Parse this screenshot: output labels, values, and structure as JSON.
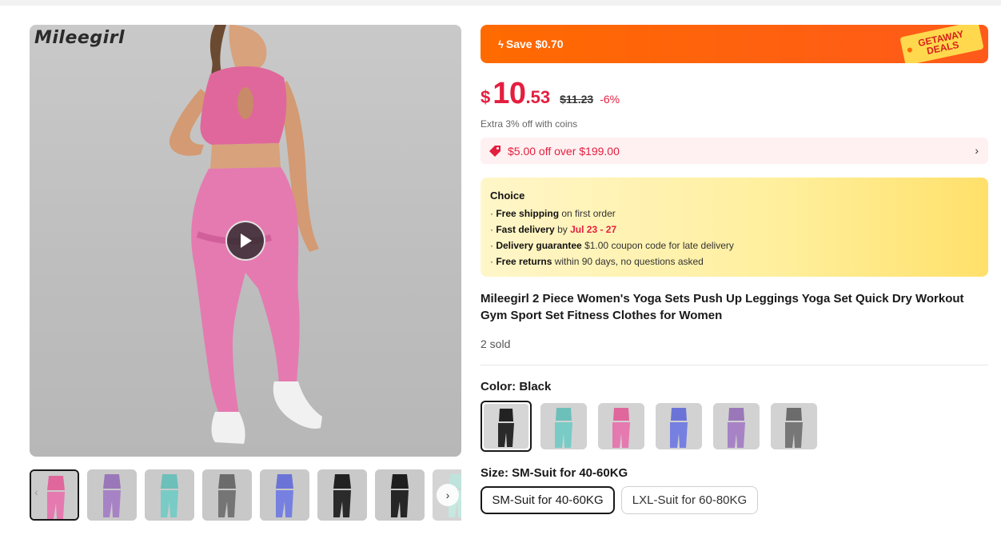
{
  "gallery": {
    "brand": "Mileegirl",
    "thumb_colors": [
      "pink",
      "purple",
      "teal",
      "grey",
      "blue",
      "black",
      "black",
      "mint"
    ]
  },
  "promo": {
    "save_text": "Save $0.70",
    "tag_line1": "GETAWAY",
    "tag_line2": "DEALS",
    "color": "#ff6a00"
  },
  "price": {
    "currency": "$",
    "integer": "10",
    "decimal": ".53",
    "original": "$11.23",
    "discount": "-6%",
    "coins_note": "Extra 3% off with coins",
    "color": "#e41e3f"
  },
  "coupon": {
    "text": "$5.00 off over $199.00"
  },
  "choice": {
    "title": "Choice",
    "shipping_bold": "Free shipping",
    "shipping_rest": "on first order",
    "delivery_bold": "Fast delivery",
    "delivery_by": "by",
    "delivery_dates": "Jul 23 - 27",
    "guarantee_bold": "Delivery guarantee",
    "guarantee_rest": "$1.00 coupon code for late delivery",
    "returns_bold": "Free returns",
    "returns_rest": "within 90 days, no questions asked"
  },
  "product": {
    "title": "Mileegirl 2 Piece Women's Yoga Sets Push Up Leggings Yoga Set Quick Dry Workout Gym Sport Set Fitness Clothes for Women",
    "sold": "2 sold"
  },
  "color_option": {
    "label": "Color: Black",
    "swatches": [
      "black",
      "teal",
      "pink",
      "blue",
      "purple",
      "grey"
    ]
  },
  "size_option": {
    "label": "Size: SM-Suit for 40-60KG",
    "options": [
      "SM-Suit for 40-60KG",
      "LXL-Suit for 60-80KG"
    ]
  }
}
